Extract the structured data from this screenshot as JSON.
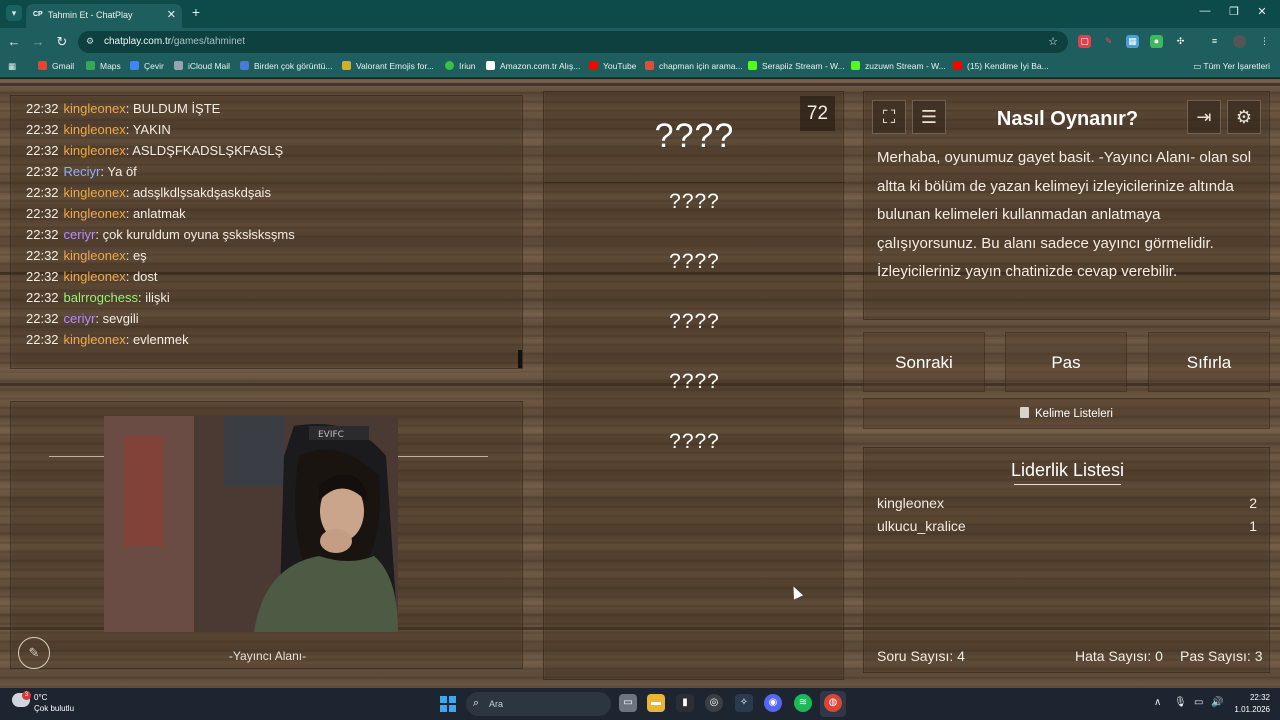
{
  "browser": {
    "tab_title": "Tahmin Et - ChatPlay",
    "tab_favicon": "CP",
    "url_host": "chatplay.com.tr",
    "url_path": "/games/tahminet",
    "bookmarks": [
      {
        "label": "Gmail",
        "color": "#ea4335"
      },
      {
        "label": "Maps",
        "color": "#34a853"
      },
      {
        "label": "Çevir",
        "color": "#4285f4"
      },
      {
        "label": "iCloud Mail",
        "color": "#9aa4ad"
      },
      {
        "label": "Birden çok görüntü...",
        "color": "#4a7bd0"
      },
      {
        "label": "Valorant Emojis for...",
        "color": "#c9b32b"
      },
      {
        "label": "Iriun",
        "color": "#38c24a"
      },
      {
        "label": "Amazon.com.tr Alış...",
        "color": "#ffffff"
      },
      {
        "label": "YouTube",
        "color": "#ff0000"
      },
      {
        "label": "chapman için arama...",
        "color": "#e54b3c"
      },
      {
        "label": "Serapiiz Stream - W...",
        "color": "#53fc18"
      },
      {
        "label": "zuzuwn Stream - W...",
        "color": "#53fc18"
      },
      {
        "label": "(15) Kendime İyi Ba...",
        "color": "#ff0000"
      }
    ],
    "all_bookmarks": "Tüm Yer İşaretleri"
  },
  "chat": {
    "messages": [
      {
        "time": "22:32",
        "user": "kingleonex",
        "color": "#f0a84a",
        "text": "BULDUM İŞTE"
      },
      {
        "time": "22:32",
        "user": "kingleonex",
        "color": "#f0a84a",
        "text": "YAKIN"
      },
      {
        "time": "22:32",
        "user": "kingleonex",
        "color": "#f0a84a",
        "text": "ASLDŞFKADSLŞKFASLŞ"
      },
      {
        "time": "22:32",
        "user": "Reciyr",
        "color": "#8fb0ff",
        "text": "Ya öf"
      },
      {
        "time": "22:32",
        "user": "kingleonex",
        "color": "#f0a84a",
        "text": "adsşlkdlşsakdşaskdşais"
      },
      {
        "time": "22:32",
        "user": "kingleonex",
        "color": "#f0a84a",
        "text": "anlatmak"
      },
      {
        "time": "22:32",
        "user": "ceriyr",
        "color": "#b98cff",
        "text": "çok kuruldum oyuna şsksłsksşms"
      },
      {
        "time": "22:32",
        "user": "kingleonex",
        "color": "#f0a84a",
        "text": "eş"
      },
      {
        "time": "22:32",
        "user": "kingleonex",
        "color": "#f0a84a",
        "text": "dost"
      },
      {
        "time": "22:32",
        "user": "balrrogchess",
        "color": "#9cf07a",
        "text": "ilişki"
      },
      {
        "time": "22:32",
        "user": "ceriyr",
        "color": "#b98cff",
        "text": "sevgili"
      },
      {
        "time": "22:32",
        "user": "kingleonex",
        "color": "#f0a84a",
        "text": "evlenmek"
      }
    ]
  },
  "stream": {
    "label": "-Yayıncı Alanı-"
  },
  "words": {
    "timer": "72",
    "main": "????",
    "others": [
      "????",
      "????",
      "????",
      "????",
      "????"
    ]
  },
  "help": {
    "title": "Nasıl Oynanır?",
    "text": "Merhaba, oyunumuz gayet basit. -Yayıncı Alanı- olan sol altta ki bölüm de yazan kelimeyi izleyicilerinize altında bulunan kelimeleri kullanmadan anlatmaya çalışıyorsunuz. Bu alanı sadece yayıncı görmelidir. İzleyicileriniz yayın chatinizde cevap verebilir."
  },
  "controls": {
    "next": "Sonraki",
    "pass": "Pas",
    "reset": "Sıfırla",
    "word_lists": "Kelime Listeleri"
  },
  "leaderboard": {
    "title": "Liderlik Listesi",
    "rows": [
      {
        "name": "kingleonex",
        "score": "2"
      },
      {
        "name": "ulkucu_kralice",
        "score": "1"
      }
    ],
    "question_count": "Soru Sayısı: 4",
    "error_count": "Hata Sayısı: 0",
    "pass_count": "Pas Sayısı: 3"
  },
  "taskbar": {
    "weather_badge": "3",
    "temp": "0°C",
    "weather": "Çok bulutlu",
    "search_placeholder": "Ara",
    "time": "22:32",
    "date": "1.01.2026"
  }
}
